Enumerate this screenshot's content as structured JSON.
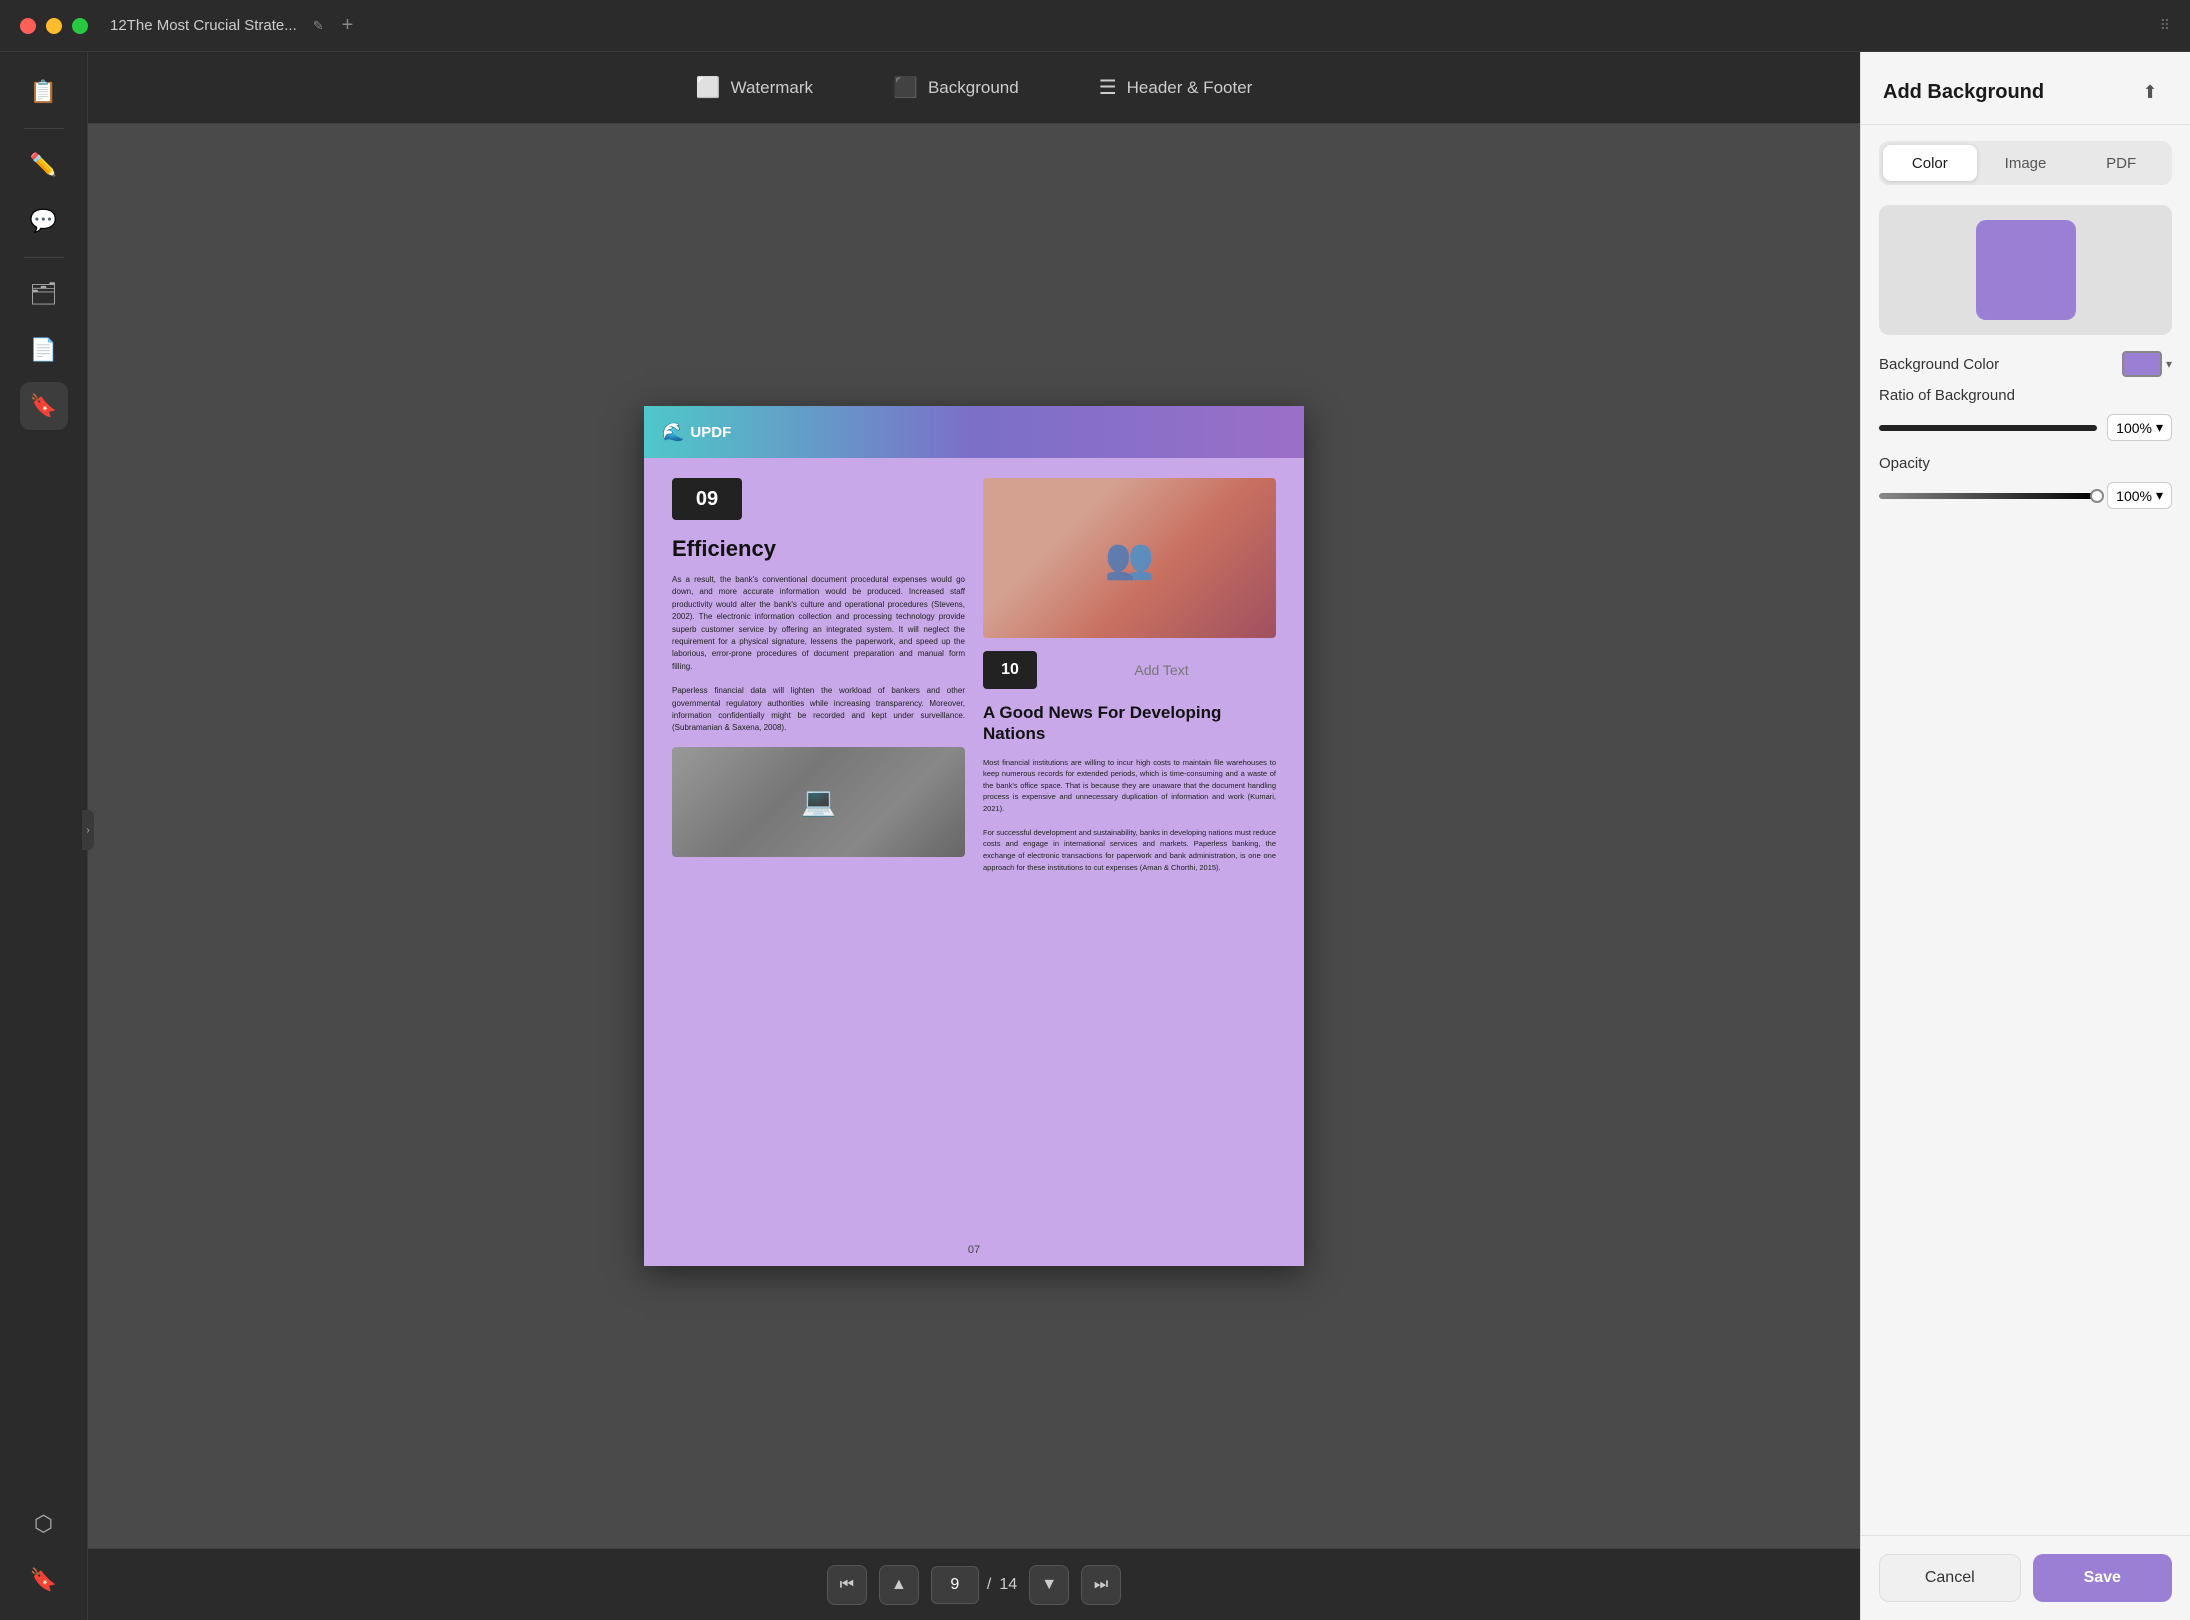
{
  "window": {
    "title": "12The Most Crucial Strate...",
    "close_label": "×",
    "min_label": "−",
    "max_label": "□",
    "add_tab": "+"
  },
  "toolbar": {
    "watermark_label": "Watermark",
    "background_label": "Background",
    "header_footer_label": "Header & Footer"
  },
  "panel": {
    "title": "Add Background",
    "tab_color": "Color",
    "tab_image": "Image",
    "tab_pdf": "PDF",
    "bg_color_label": "Background Color",
    "ratio_label": "Ratio of Background",
    "opacity_label": "Opacity",
    "ratio_value": "100%",
    "opacity_value": "100%",
    "cancel_label": "Cancel",
    "save_label": "Save"
  },
  "navigation": {
    "current_page": "9",
    "total_pages": "14",
    "separator": "/"
  },
  "pdf_content": {
    "section_09": "09",
    "section_title": "Efficiency",
    "body_text_1": "As a result, the bank's conventional document procedural expenses would go down, and more accurate information would be produced. Increased staff productivity would alter the bank's culture and operational procedures (Stevens, 2002). The electronic information collection and processing technology provide superb customer service by offering an integrated system. It will neglect the requirement for a physical signature, lessens the paperwork, and speed up the laborious, error-prone procedures of document preparation and manual form filling.",
    "body_text_2": "Paperless financial data will lighten the workload of bankers and other governmental regulatory authorities while increasing transparency. Moreover, information confidentially might be recorded and kept under surveillance. (Subramanian & Saxena, 2008).",
    "section_10": "10",
    "add_text": "Add Text",
    "right_heading": "A Good News For Developing Nations",
    "right_text_1": "Most financial institutions are willing to incur high costs to maintain file warehouses to keep numerous records for extended periods, which is time-consuming and a waste of the bank's office space. That is because they are unaware that the document handling process is expensive and unnecessary duplication of information and work (Kumari, 2021).",
    "right_text_2": "For successful development and sustainability, banks in developing nations must reduce costs and engage in international services and markets. Paperless banking, the exchange of electronic transactions for paperwork and bank administration, is one one approach for these institutions to cut expenses (Aman & Chorthi, 2015).",
    "page_number": "07",
    "logo_text": "UPDF"
  },
  "sidebar": {
    "icons": [
      {
        "name": "document-icon",
        "symbol": "📋"
      },
      {
        "name": "edit-icon",
        "symbol": "✏️"
      },
      {
        "name": "comment-icon",
        "symbol": "💬"
      },
      {
        "name": "pages-icon",
        "symbol": "🗂"
      },
      {
        "name": "convert-icon",
        "symbol": "📄"
      },
      {
        "name": "stamp-icon",
        "symbol": "🔖"
      },
      {
        "name": "layers-icon",
        "symbol": "⬡"
      },
      {
        "name": "bookmark-icon",
        "symbol": "🔖"
      }
    ]
  }
}
